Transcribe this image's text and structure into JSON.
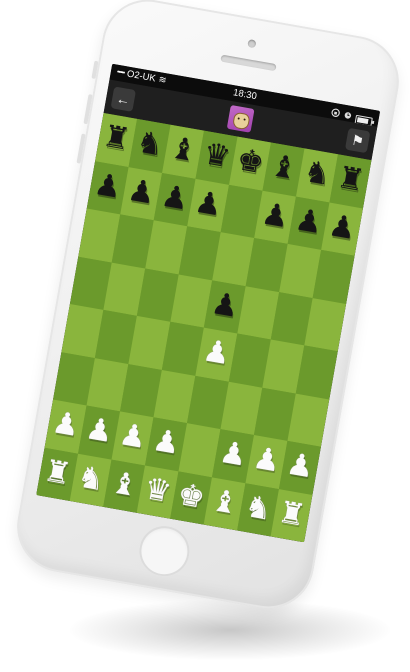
{
  "status_bar": {
    "signal_dots": "•••••",
    "carrier": "O2-UK",
    "wifi_glyph": "≋",
    "time": "18:30",
    "icons": [
      "lock-rotation-icon",
      "alarm-icon",
      "battery-icon"
    ]
  },
  "top_bar": {
    "back_glyph": "←",
    "flag_glyph": "⚑",
    "opponent_avatar": "cow-avatar"
  },
  "board": {
    "light_color": "#8ab53d",
    "dark_color": "#6b9a2c",
    "piece_glyphs": {
      "K": "♚",
      "Q": "♛",
      "R": "♜",
      "B": "♝",
      "N": "♞",
      "P": "♟"
    },
    "rows": [
      [
        "bR",
        "bN",
        "bB",
        "bQ",
        "bK",
        "bB",
        "bN",
        "bR"
      ],
      [
        "bP",
        "bP",
        "bP",
        "bP",
        "",
        "bP",
        "bP",
        "bP"
      ],
      [
        "",
        "",
        "",
        "",
        "",
        "",
        "",
        ""
      ],
      [
        "",
        "",
        "",
        "",
        "bP",
        "",
        "",
        ""
      ],
      [
        "",
        "",
        "",
        "",
        "wP",
        "",
        "",
        ""
      ],
      [
        "",
        "",
        "",
        "",
        "",
        "",
        "",
        ""
      ],
      [
        "wP",
        "wP",
        "wP",
        "wP",
        "",
        "wP",
        "wP",
        "wP"
      ],
      [
        "wR",
        "wN",
        "wB",
        "wQ",
        "wK",
        "wB",
        "wN",
        "wR"
      ]
    ]
  }
}
